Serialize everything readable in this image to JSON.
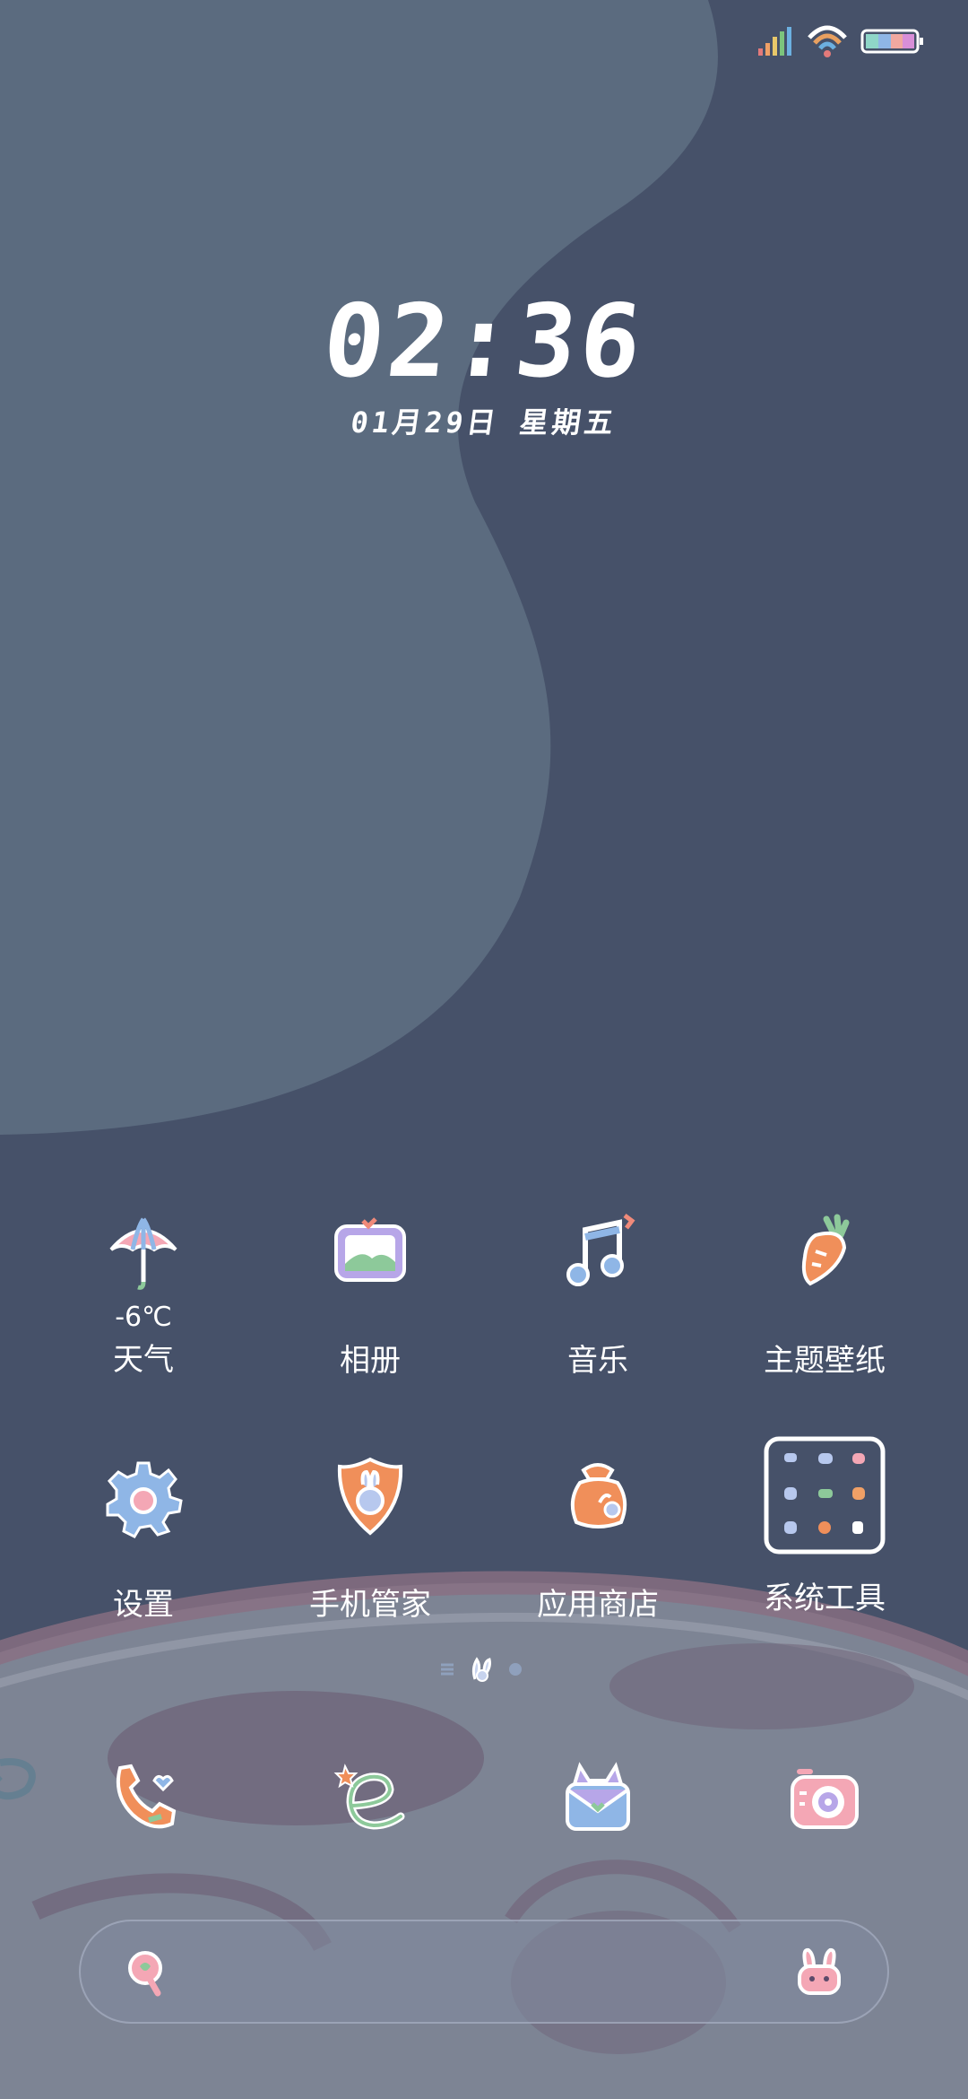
{
  "status_bar": {
    "signal_icon": "signal-bars-icon",
    "wifi_icon": "wifi-icon",
    "battery_icon": "battery-icon"
  },
  "lockscreen": {
    "time": "02:36",
    "date": "01月29日  星期五"
  },
  "apps_row1": [
    {
      "label": "天气",
      "sub": "-6℃",
      "icon": "umbrella-icon"
    },
    {
      "label": "相册",
      "icon": "photo-frame-icon"
    },
    {
      "label": "音乐",
      "icon": "music-note-icon"
    },
    {
      "label": "主题壁纸",
      "icon": "carrot-icon"
    }
  ],
  "apps_row2": [
    {
      "label": "设置",
      "icon": "gear-icon"
    },
    {
      "label": "手机管家",
      "icon": "shield-bunny-icon"
    },
    {
      "label": "应用商店",
      "icon": "bag-icon"
    },
    {
      "label": "系统工具",
      "icon": "folder-grid-icon"
    }
  ],
  "dock": [
    {
      "icon": "phone-icon"
    },
    {
      "icon": "browser-icon"
    },
    {
      "icon": "messages-icon"
    },
    {
      "icon": "camera-icon"
    }
  ],
  "search_bar": {
    "left_icon": "search-icon",
    "right_icon": "bunny-icon"
  },
  "colors": {
    "background": "#465169",
    "blob": "#5b6b7f",
    "planet": "#7d8494",
    "planet_rim": "#8a6f82"
  }
}
